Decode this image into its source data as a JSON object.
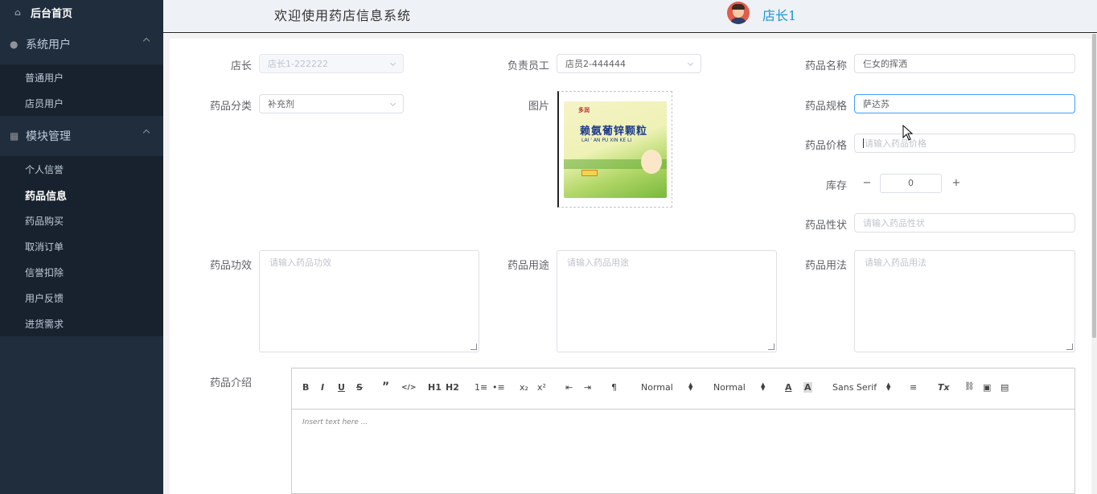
{
  "sidebar": {
    "home": "后台首页",
    "groups": [
      {
        "label": "系统用户",
        "items": [
          "普通用户",
          "店员用户"
        ]
      },
      {
        "label": "模块管理",
        "items": [
          "个人信誉",
          "药品信息",
          "药品购买",
          "取消订单",
          "信誉扣除",
          "用户反馈",
          "进货需求"
        ]
      }
    ],
    "active_item": "药品信息"
  },
  "header": {
    "welcome": "欢迎使用药店信息系统",
    "username": "店长1"
  },
  "form": {
    "store_manager": {
      "label": "店长",
      "value": "店长1-222222"
    },
    "staff": {
      "label": "负责员工",
      "value": "店员2-444444"
    },
    "drug_name": {
      "label": "药品名称",
      "value": "仨女的挥洒"
    },
    "category": {
      "label": "药品分类",
      "value": "补充剂"
    },
    "image": {
      "label": "图片"
    },
    "spec": {
      "label": "药品规格",
      "value": "萨达苏"
    },
    "price": {
      "label": "药品价格",
      "placeholder": "请输入药品价格"
    },
    "stock": {
      "label": "库存",
      "value": "0",
      "minus": "−",
      "plus": "+"
    },
    "nature": {
      "label": "药品性状",
      "placeholder": "请输入药品性状"
    },
    "efficacy": {
      "label": "药品功效",
      "placeholder": "请输入药品功效"
    },
    "usage_purpose": {
      "label": "药品用途",
      "placeholder": "请输入药品用途"
    },
    "usage_method": {
      "label": "药品用法",
      "placeholder": "请输入药品用法"
    },
    "intro": {
      "label": "药品介绍"
    }
  },
  "product_image": {
    "brand": "多润",
    "title": "赖氨葡锌颗粒",
    "pinyin": "LAI ' AN PU XIN KE LI"
  },
  "editor": {
    "toolbar": {
      "bold": "B",
      "italic": "I",
      "underline": "U",
      "strike": "S",
      "quote": "”",
      "code": "</>",
      "h1": "H1",
      "h2": "H2",
      "ol": "1≡",
      "ul": "•≡",
      "sub": "x₂",
      "sup": "x²",
      "outdent": "⇤",
      "indent": "⇥",
      "rtl": "¶",
      "size": "Normal",
      "header": "Normal",
      "color": "A",
      "bg": "A",
      "font": "Sans Serif",
      "align": "≡",
      "clean": "Tx",
      "link": "🔗",
      "image": "▣",
      "video": "▤"
    },
    "placeholder": "Insert text here ..."
  }
}
